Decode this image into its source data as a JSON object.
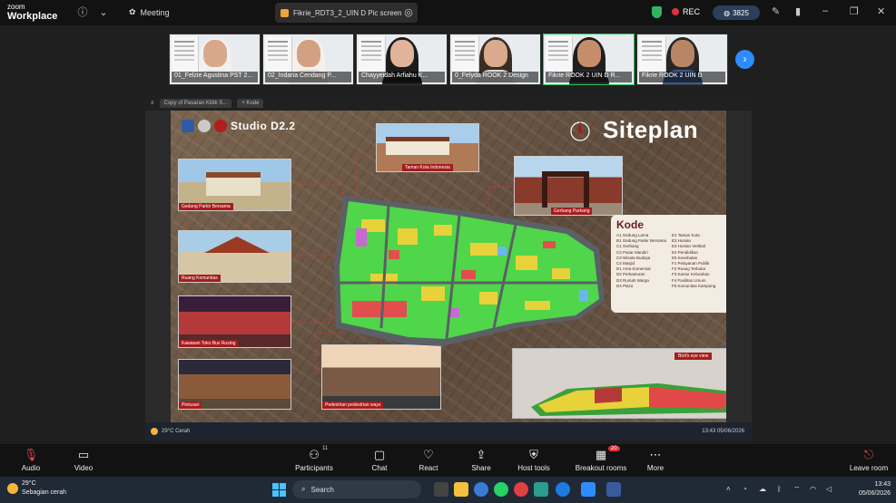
{
  "app": {
    "brand_line1": "zoom",
    "brand_line2": "Workplace",
    "meeting_menu": "Meeting",
    "share_tab_title": "Fikrie_RDT3_2_UIN D Pic screen",
    "rec_label": "REC",
    "badge_label": "3825"
  },
  "participants": [
    {
      "name": "01_Felzie Agustina PST 2...",
      "face": "#d7a98a",
      "hood": "#f1f1f1",
      "body": "#e9e9e9"
    },
    {
      "name": "02_Indana Cendang P...",
      "face": "#d2a184",
      "hood": "#f4f0ea",
      "body": "#e0ded9"
    },
    {
      "name": "Chayyeidah Arfiahu K...",
      "face": "#e0b49a",
      "hood": "#1c1c1c",
      "body": "#1c1c1c"
    },
    {
      "name": "0_Felyda ROOK 2 Design",
      "face": "#d9aa8e",
      "hood": "#3a2c25",
      "body": "#dcdcdc"
    },
    {
      "name": "Fikrie ROOK 2 UIN D R...",
      "face": "#c68d6d",
      "hood": "#1f1f1f",
      "body": "#2a2a2a"
    },
    {
      "name": "Fikrie ROOK 2 UIN D",
      "face": "#b88566",
      "hood": "#262626",
      "body": "#3b5a8c"
    }
  ],
  "shared_screen": {
    "browser_tab": "Copy of Pasaran Klitik S...",
    "browser_tab2": "+ Kode",
    "studio_label": "Studio D2.2",
    "title": "Siteplan",
    "photos": [
      {
        "caption": "Gedung Parkir Bersama"
      },
      {
        "caption": "Taman Kota Indonesia"
      },
      {
        "caption": "Gerbang Parkang"
      },
      {
        "caption": "Ruang Komunitas"
      },
      {
        "caption": "Kawasan Toko Bus Rusing"
      },
      {
        "caption": "Pintusari"
      },
      {
        "caption": "Pedestrian pedestrian ways"
      }
    ],
    "kode": {
      "title": "Kode",
      "left": [
        "A1 Gedung Lama",
        "B1 Gedung Parkir Bersama",
        "C1 Gerbang",
        "C2 Pasar Mandiri",
        "C3 Wisata Budaya",
        "C4 Masjid",
        "D1 Area Komersial",
        "D2 Perkantoran",
        "D3 Rumah Warga",
        "D4 Plaza"
      ],
      "right": [
        "E1 Taman Kota",
        "E2 Hunian",
        "E3 Hunian Vertikal",
        "E4 Pendidikan",
        "E5 Kesehatan",
        "F1 Pelayanan Publik",
        "F2 Ruang Terbuka",
        "F3 Kantor Kelurahan",
        "F4 Fasilitas Umum",
        "F5 Komunitas Kampung"
      ]
    },
    "birdseye_caption": "Bird's eye view",
    "inner_weather": "29°C Cerah",
    "inner_clock": "13:43 05/06/2026"
  },
  "toolbar": {
    "audio": "Audio",
    "video": "Video",
    "participants": "Participants",
    "participants_count": "11",
    "chat": "Chat",
    "react": "React",
    "share": "Share",
    "host_tools": "Host tools",
    "breakout": "Breakout rooms",
    "breakout_badge": "20",
    "more": "More",
    "leave": "Leave room"
  },
  "taskbar": {
    "temp": "29°C",
    "weather": "Sebagian cerah",
    "search_placeholder": "Search",
    "time": "13:43",
    "date": "05/06/2026"
  }
}
